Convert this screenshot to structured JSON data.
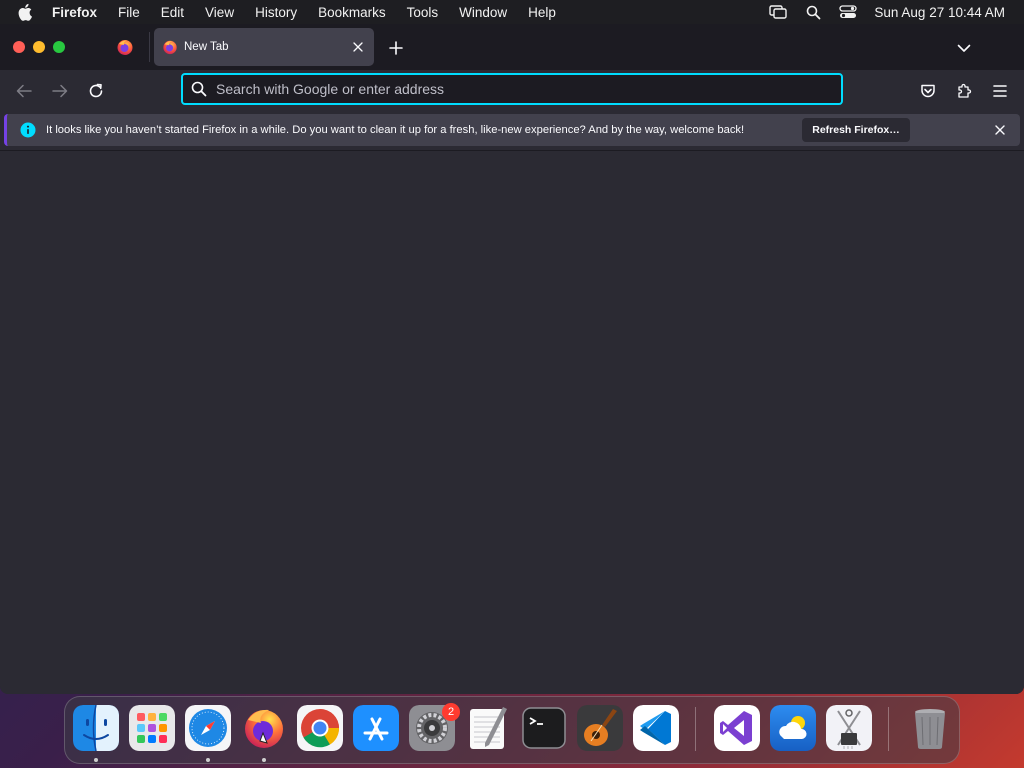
{
  "menubar": {
    "app_name": "Firefox",
    "menus": [
      "File",
      "Edit",
      "View",
      "History",
      "Bookmarks",
      "Tools",
      "Window",
      "Help"
    ],
    "clock": "Sun Aug 27  10:44 AM"
  },
  "tabs": {
    "active_title": "New Tab"
  },
  "urlbar": {
    "placeholder": "Search with Google or enter address"
  },
  "notification": {
    "message": "It looks like you haven’t started Firefox in a while. Do you want to clean it up for a fresh, like-new experience? And by the way, welcome back!",
    "button_label": "Refresh Firefox…"
  },
  "dock": {
    "apps": [
      "finder",
      "launchpad",
      "safari",
      "firefox",
      "chrome",
      "app-store",
      "system-settings",
      "textedit",
      "terminal",
      "garageband",
      "vscode",
      "visual-studio",
      "weather",
      "system-information",
      "trash"
    ],
    "system_settings_badge": "2"
  },
  "colors": {
    "window_bg": "#2b2a33",
    "tabstrip_bg": "#1c1b22",
    "url_focus": "#00ddff",
    "notification_accent": "#7542e5"
  }
}
